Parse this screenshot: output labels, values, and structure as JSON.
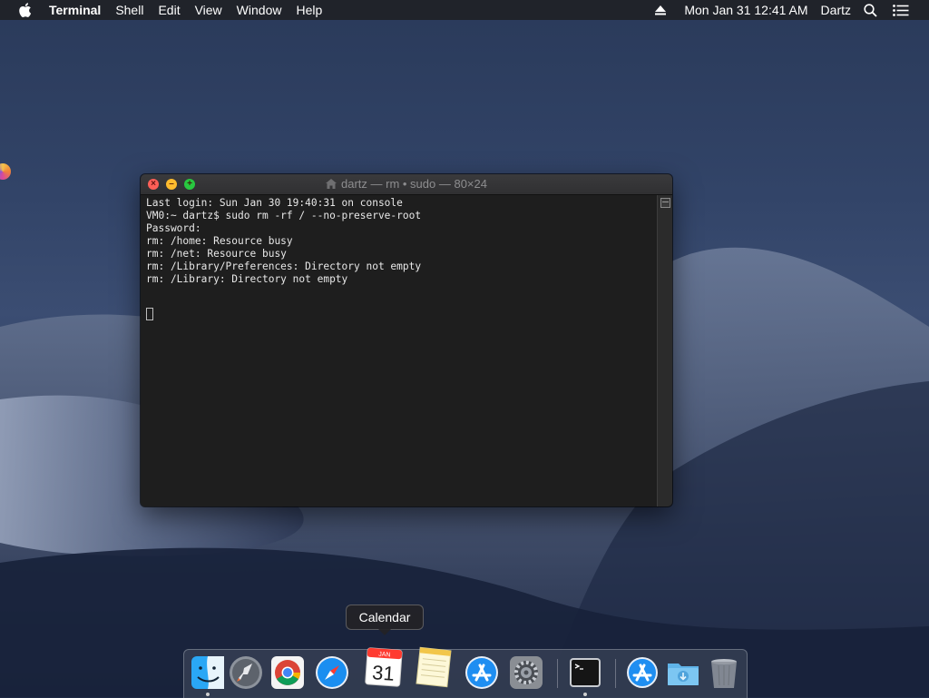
{
  "menubar": {
    "app_name": "Terminal",
    "menus": [
      "Shell",
      "Edit",
      "View",
      "Window",
      "Help"
    ],
    "clock": "Mon Jan 31  12:41 AM",
    "user": "Dartz"
  },
  "terminal": {
    "title": "dartz — rm • sudo — 80×24",
    "lines": [
      "Last login: Sun Jan 30 19:40:31 on console",
      "VM0:~ dartz$ sudo rm -rf / --no-preserve-root",
      "Password:",
      "rm: /home: Resource busy",
      "rm: /net: Resource busy",
      "rm: /Library/Preferences: Directory not empty",
      "rm: /Library: Directory not empty"
    ]
  },
  "tooltip": {
    "label": "Calendar"
  },
  "dock": {
    "items": [
      {
        "name": "Finder",
        "icon": "finder-icon",
        "running": true
      },
      {
        "name": "Launchpad",
        "icon": "launchpad-icon",
        "running": false
      },
      {
        "name": "Google Chrome",
        "icon": "chrome-icon",
        "running": false
      },
      {
        "name": "Safari",
        "icon": "safari-icon",
        "running": false
      },
      {
        "name": "Calendar",
        "icon": "calendar-icon",
        "running": false,
        "month": "JAN",
        "day": "31"
      },
      {
        "name": "Notes",
        "icon": "notes-icon",
        "running": false
      },
      {
        "name": "App Store",
        "icon": "app-store-icon",
        "running": false
      },
      {
        "name": "System Preferences",
        "icon": "system-preferences-icon",
        "running": false
      },
      {
        "name": "Terminal",
        "icon": "terminal-icon",
        "running": true
      },
      {
        "name": "Applications",
        "icon": "applications-folder-icon",
        "running": false
      },
      {
        "name": "Downloads",
        "icon": "downloads-folder-icon",
        "running": false
      },
      {
        "name": "Trash",
        "icon": "trash-icon",
        "running": false
      }
    ]
  }
}
